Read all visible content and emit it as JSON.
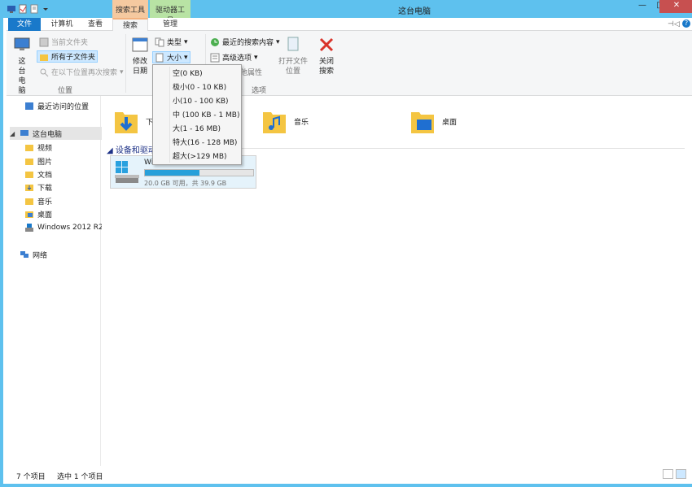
{
  "window": {
    "title": "这台电脑"
  },
  "context_tabs": {
    "search_tools": "搜索工具",
    "drive_tools": "驱动器工具"
  },
  "tabs": {
    "file": "文件",
    "computer": "计算机",
    "view": "查看",
    "search": "搜索",
    "manage": "管理"
  },
  "ribbon": {
    "this_pc": "这台电脑",
    "current_folder": "当前文件夹",
    "all_subfolders": "所有子文件夹",
    "search_again_in": "在以下位置再次搜索",
    "group_location": "位置",
    "date_modified": "修改日期",
    "kind": "类型",
    "size": "大小",
    "other_properties": "其他属性",
    "recent_searches": "最近的搜索内容",
    "advanced_options": "高级选项",
    "open_file_location": "打开文件位置",
    "close_search": "关闭搜索",
    "group_options": "选项"
  },
  "size_menu": {
    "items": [
      "空(0 KB)",
      "极小(0 - 10 KB)",
      "小(10 - 100 KB)",
      "中 (100 KB - 1 MB)",
      "大(1 - 16 MB)",
      "特大(16 - 128 MB)",
      "超大(>129 MB)"
    ]
  },
  "nav": {
    "recent_places": "最近访问的位置",
    "this_pc": "这台电脑",
    "videos": "视频",
    "pictures": "图片",
    "documents": "文档",
    "downloads": "下载",
    "music": "音乐",
    "desktop": "桌面",
    "drive": "Windows 2012 R2",
    "network": "网络"
  },
  "content": {
    "folders": [
      "下载",
      "音乐",
      "桌面"
    ],
    "devices_header": "设备和驱动器",
    "drive": {
      "name": "Windows 2012 R2 (C:)",
      "free_text": "20.0 GB 可用，共 39.9 GB",
      "used_fraction": 0.5
    }
  },
  "status": {
    "item_count": "7 个项目",
    "selected": "选中 1 个项目"
  },
  "colors": {
    "titlebar": "#5ec1ee",
    "file_tab": "#1979ca",
    "search_ctx": "#f5c9a0",
    "drive_ctx": "#b8e3a4",
    "close": "#c75050",
    "folder": "#f4c542",
    "drive_fill": "#26a0da"
  }
}
